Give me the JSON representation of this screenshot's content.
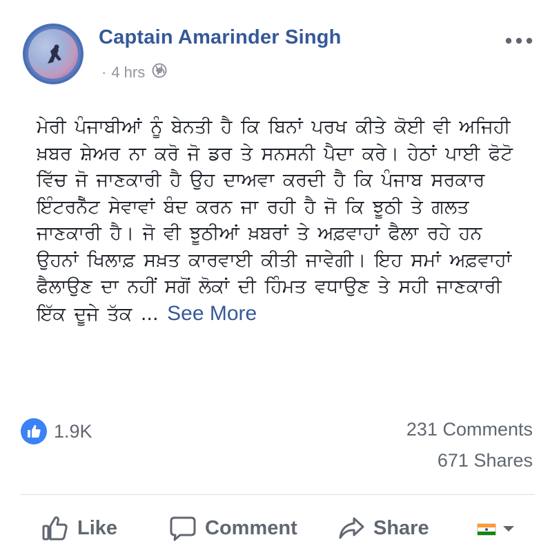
{
  "post": {
    "author": "Captain Amarinder Singh",
    "time": "4 hrs",
    "separator": "·",
    "body_lines": [
      "ਮੇਰੀ ਪੰਜਾਬੀਆਂ ਨੂੰ ਬੇਨਤੀ ਹੈ ਕਿ ਬਿਨਾਂ ਪਰਖ ਕੀਤੇ ਕੋਈ ਵੀ ਅਜਿਹੀ",
      "ਖ਼ਬਰ ਸ਼ੇਅਰ ਨਾ ਕਰੋ ਜੋ ਡਰ ਤੇ ਸਨਸਨੀ ਪੈਦਾ ਕਰੇ। ਹੇਠਾਂ ਪਾਈ ਫੋਟੋ",
      "ਵਿੱਚ ਜੋ ਜਾਣਕਾਰੀ ਹੈ ਉਹ ਦਾਅਵਾ ਕਰਦੀ ਹੈ ਕਿ ਪੰਜਾਬ ਸਰਕਾਰ",
      "ਇੰਟਰਨੈੱਟ ਸੇਵਾਵਾਂ ਬੰਦ ਕਰਨ ਜਾ ਰਹੀ ਹੈ ਜੋ ਕਿ ਝੂਠੀ ਤੇ ਗਲਤ",
      "ਜਾਣਕਾਰੀ ਹੈ। ਜੋ ਵੀ ਝੂਠੀਆਂ ਖ਼ਬਰਾਂ ਤੇ ਅਫ਼ਵਾਹਾਂ ਫੈਲਾ ਰਹੇ ਹਨ",
      "ਉਹਨਾਂ ਖਿਲਾਫ਼ ਸਖ਼ਤ ਕਾਰਵਾਈ ਕੀਤੀ ਜਾਵੇਗੀ। ਇਹ ਸਮਾਂ ਅਫ਼ਵਾਹਾਂ",
      "ਫੈਲਾਉਣ ਦਾ ਨਹੀਂ ਸਗੋਂ ਲੋਕਾਂ ਦੀ ਹਿੰਮਤ ਵਧਾਉਣ ਤੇ ਸਹੀ ਜਾਣਕਾਰੀ"
    ],
    "body_last_line": "ਇੱਕ ਦੂਜੇ ਤੱਕ ...",
    "see_more": "See More"
  },
  "stats": {
    "reaction_count": "1.9K",
    "comments": "231 Comments",
    "shares": "671 Shares"
  },
  "actions": {
    "like": "Like",
    "comment": "Comment",
    "share": "Share"
  },
  "icons": {
    "avatar": "profile-picture",
    "globe": "globe-icon",
    "more": "more-options-icon",
    "like_badge": "thumbs-up-icon",
    "like": "thumbs-up-outline-icon",
    "comment": "speech-bubble-icon",
    "share": "share-arrow-icon",
    "audience": "flag-audience-icon"
  },
  "colors": {
    "author": "#365899",
    "link": "#365899",
    "muted": "#606770",
    "like_blue": "#3a82f6"
  }
}
